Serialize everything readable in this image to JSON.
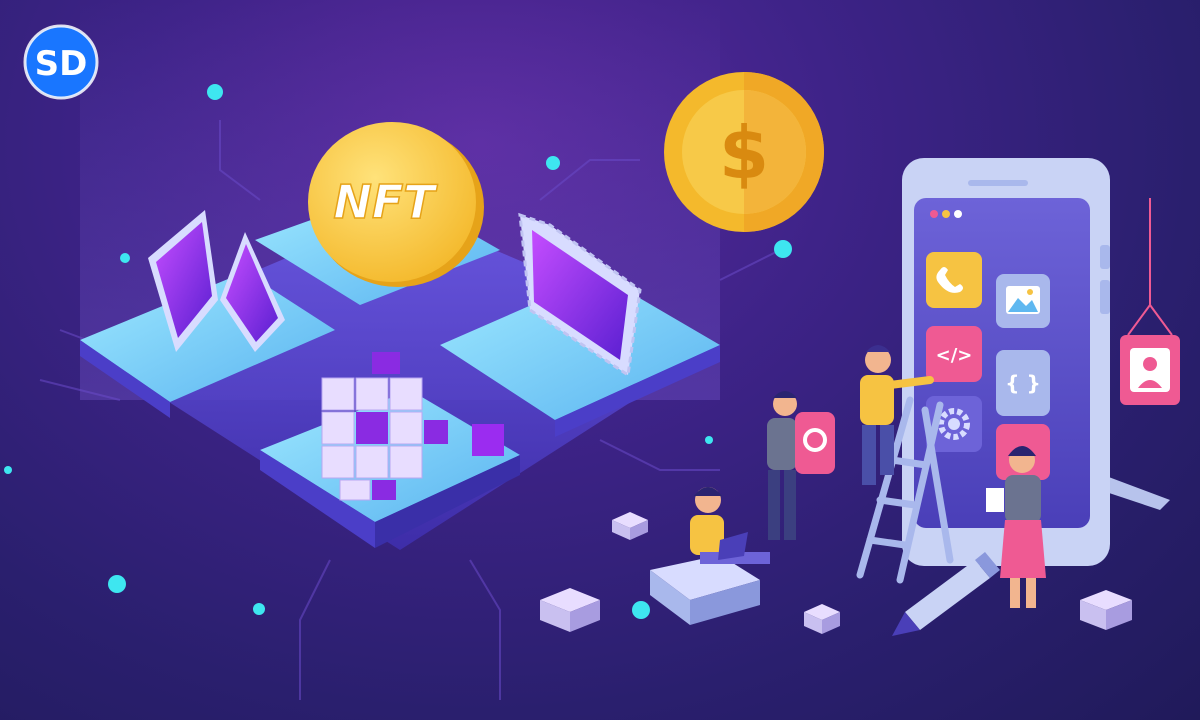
{
  "logo": {
    "monogram": "SD",
    "icon": "sd-logo-icon"
  },
  "coin_nft": {
    "label": "NFT",
    "icon": "nft-coin-icon"
  },
  "coin_dollar": {
    "symbol": "$",
    "icon": "dollar-coin-icon"
  },
  "app_icons": [
    {
      "name": "phone-icon"
    },
    {
      "name": "image-icon"
    },
    {
      "name": "code-icon",
      "glyph": "</>"
    },
    {
      "name": "braces-icon",
      "glyph": "{ }"
    },
    {
      "name": "gear-icon"
    },
    {
      "name": "app-tile-icon"
    }
  ],
  "hanging_sign": {
    "icon": "user-profile-icon"
  },
  "colors": {
    "bg_dark": "#201a5a",
    "bg_mid": "#3e2388",
    "accent_cyan": "#3ee6f0",
    "coin_gold": "#f7c948",
    "phone_body": "#c9d3f5",
    "tile_yellow": "#f6c342",
    "tile_pink": "#ef5a93",
    "tile_blue": "#a9b8ec",
    "logo_blue": "#1976ff"
  }
}
